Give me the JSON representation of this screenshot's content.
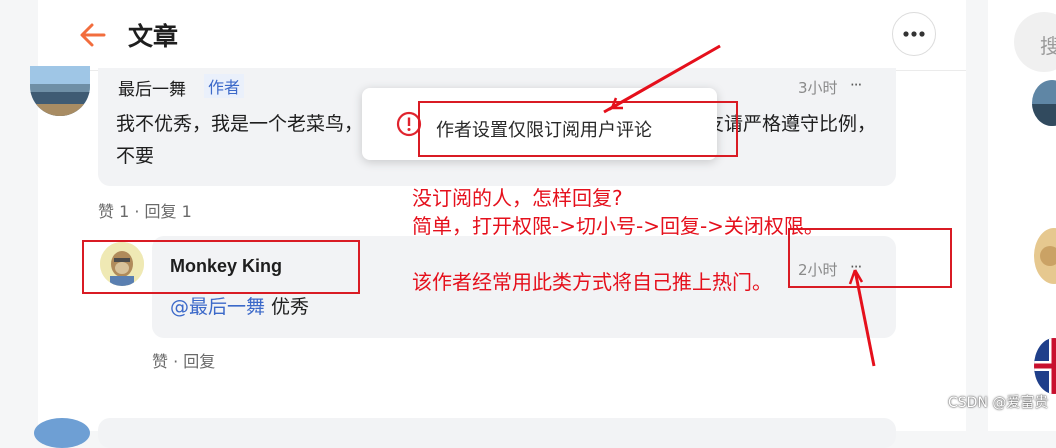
{
  "header": {
    "title": "文章"
  },
  "comment1": {
    "name": "最后一舞",
    "tag": "作者",
    "time": "3小时",
    "more": "···",
    "text": "我不优秀，我是一个老菜鸟，每天回复很多人，今天也开启，跟随的朋友请严格遵守比例，不要",
    "likes": "赞 1",
    "replies": "回复 1"
  },
  "popup": {
    "message": "作者设置仅限订阅用户评论"
  },
  "comment2": {
    "name": "Monkey King",
    "time": "2小时",
    "more": "···",
    "mention": "@最后一舞",
    "text": " 优秀",
    "like": "赞",
    "reply": "回复"
  },
  "annotation": {
    "text": "没订阅的人，怎样回复?\n简单，打开权限->切小号->回复->关闭权限。\n\n该作者经常用此类方式将自己推上热门。"
  },
  "sidebar": {
    "search_placeholder": "搜"
  },
  "watermark": "CSDN @爱富贵",
  "colors": {
    "accent": "#f26d3d",
    "link": "#3c69c9",
    "annotation": "#e5101c"
  }
}
